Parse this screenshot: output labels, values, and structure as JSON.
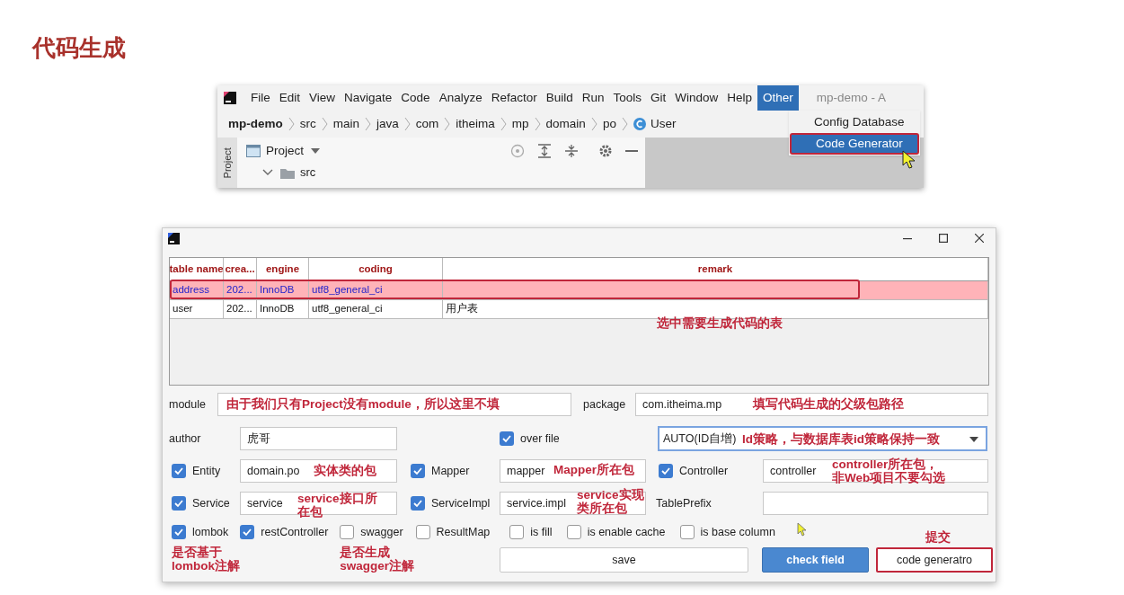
{
  "slide_title": "代码生成",
  "ide": {
    "menu": [
      {
        "label": "File",
        "selected": false
      },
      {
        "label": "Edit",
        "selected": false
      },
      {
        "label": "View",
        "selected": false
      },
      {
        "label": "Navigate",
        "selected": false
      },
      {
        "label": "Code",
        "selected": false
      },
      {
        "label": "Analyze",
        "selected": false
      },
      {
        "label": "Refactor",
        "selected": false
      },
      {
        "label": "Build",
        "selected": false
      },
      {
        "label": "Run",
        "selected": false
      },
      {
        "label": "Tools",
        "selected": false
      },
      {
        "label": "Git",
        "selected": false
      },
      {
        "label": "Window",
        "selected": false
      },
      {
        "label": "Help",
        "selected": false
      },
      {
        "label": "Other",
        "selected": true
      }
    ],
    "window_title": "mp-demo - A",
    "breadcrumb": [
      "mp-demo",
      "src",
      "main",
      "java",
      "com",
      "itheima",
      "mp",
      "domain",
      "po",
      "User"
    ],
    "dropdown": [
      {
        "label": "Config Database",
        "selected": false
      },
      {
        "label": "Code Generator",
        "selected": true
      }
    ],
    "side_tab": "Project",
    "panel_title": "Project",
    "tree": [
      {
        "label": "src",
        "expanded": true
      }
    ]
  },
  "dialog": {
    "table": {
      "columns": [
        "table name",
        "crea...",
        "engine",
        "coding",
        "remark"
      ],
      "rows": [
        {
          "cells": [
            "address",
            "202...",
            "InnoDB",
            "utf8_general_ci",
            ""
          ],
          "selected": true
        },
        {
          "cells": [
            "user",
            "202...",
            "InnoDB",
            "utf8_general_ci",
            "用户表"
          ],
          "selected": false
        }
      ],
      "note": "选中需要生成代码的表"
    },
    "form": {
      "module": {
        "label": "module",
        "note": "由于我们只有Project没有module，所以这里不填"
      },
      "package": {
        "label": "package",
        "value": "com.itheima.mp",
        "note": "填写代码生成的父级包路径"
      },
      "author": {
        "label": "author",
        "value": "虎哥"
      },
      "over_file": {
        "label": "over file",
        "checked": true
      },
      "id_strategy": {
        "value": "AUTO(ID自增)",
        "note": "Id策略，与数据库表id策略保持一致"
      },
      "entity": {
        "label": "Entity",
        "checked": true,
        "value": "domain.po",
        "note": "实体类的包"
      },
      "mapper": {
        "label": "Mapper",
        "checked": true,
        "value": "mapper",
        "note": "Mapper所在包"
      },
      "controller": {
        "label": "Controller",
        "checked": true,
        "value": "controller",
        "note": "controller所在包，非Web项目不要勾选"
      },
      "service": {
        "label": "Service",
        "checked": true,
        "value": "service",
        "note": "service接口所在包"
      },
      "service_impl": {
        "label": "ServiceImpl",
        "checked": true,
        "value": "service.impl",
        "note": "service实现类所在包"
      },
      "table_prefix": {
        "label": "TablePrefix"
      },
      "options": [
        {
          "label": "lombok",
          "checked": true,
          "note": "是否基于lombok注解"
        },
        {
          "label": "restController",
          "checked": true
        },
        {
          "label": "swagger",
          "checked": false,
          "note": "是否生成swagger注解"
        },
        {
          "label": "ResultMap",
          "checked": false
        },
        {
          "label": "is fill",
          "checked": false
        },
        {
          "label": "is enable cache",
          "checked": false
        },
        {
          "label": "is base column",
          "checked": false
        }
      ],
      "buttons": [
        {
          "label": "save",
          "kind": "plain"
        },
        {
          "label": "check field",
          "kind": "primary"
        },
        {
          "label": "code generatro",
          "kind": "highlighted",
          "note": "提交"
        }
      ]
    }
  }
}
